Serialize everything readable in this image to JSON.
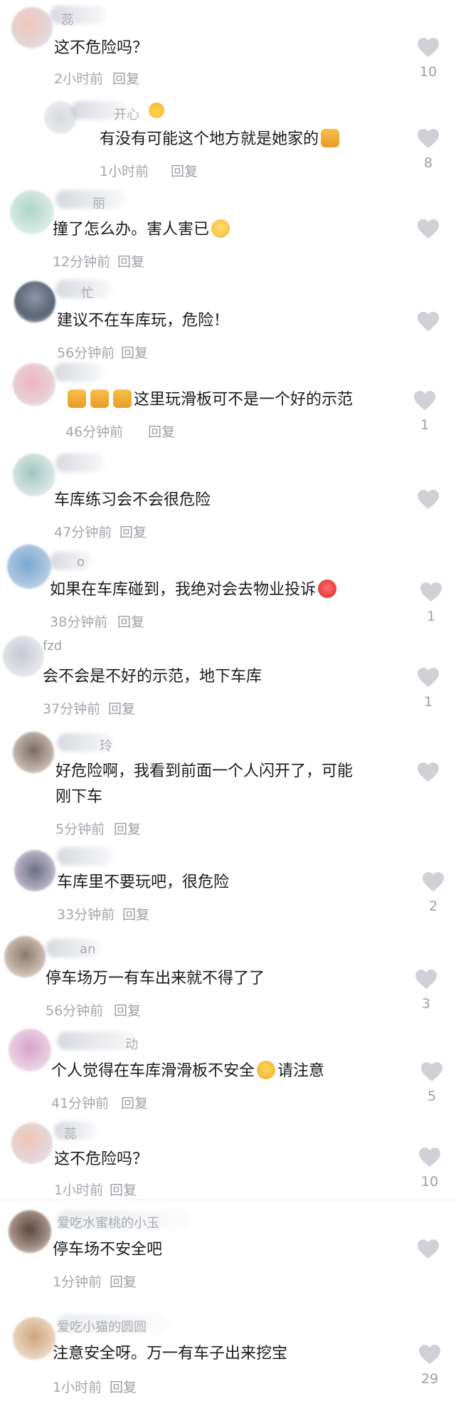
{
  "colors": {
    "text": "#1b1b1f",
    "meta": "#a3a6ad",
    "heart": "#cfd1d6"
  },
  "comments": [
    {
      "name_fragment": "蕊",
      "text": "这不危险吗？",
      "time": "2小时前",
      "reply": "回复",
      "likes": "10"
    },
    {
      "name_fragment": "开心",
      "text": "有没有可能这个地方就是她家的",
      "time": "1小时前",
      "reply": "回复",
      "likes": "8"
    },
    {
      "name_fragment": "丽",
      "text": "撞了怎么办。害人害已",
      "time": "12分钟前",
      "reply": "回复",
      "likes": ""
    },
    {
      "name_fragment": "忙",
      "text": "建议不在车库玩，危险！",
      "time": "56分钟前",
      "reply": "回复",
      "likes": ""
    },
    {
      "name_fragment": "",
      "text": "这里玩滑板可不是一个好的示范",
      "time": "46分钟前",
      "reply": "回复",
      "likes": "1"
    },
    {
      "name_fragment": "",
      "text": "车库练习会不会很危险",
      "time": "47分钟前",
      "reply": "回复",
      "likes": ""
    },
    {
      "name_fragment": "o",
      "text": "如果在车库碰到，我绝对会去物业投诉",
      "time": "38分钟前",
      "reply": "回复",
      "likes": "1"
    },
    {
      "name_fragment": "fzd",
      "text": "会不会是不好的示范，地下车库",
      "time": "37分钟前",
      "reply": "回复",
      "likes": "1"
    },
    {
      "name_fragment": "玲",
      "text_line1": "好危险啊，我看到前面一个人闪开了，可能",
      "text_line2": "刚下车",
      "time": "5分钟前",
      "reply": "回复",
      "likes": ""
    },
    {
      "name_fragment": "",
      "text": "车库里不要玩吧，很危险",
      "time": "33分钟前",
      "reply": "回复",
      "likes": "2"
    },
    {
      "name_fragment": "an",
      "text": "停车场万一有车出来就不得了了",
      "time": "56分钟前",
      "reply": "回复",
      "likes": "3"
    },
    {
      "name_fragment": "动",
      "text": "个人觉得在车库滑滑板不安全",
      "text_after": "请注意",
      "time": "41分钟前",
      "reply": "回复",
      "likes": "5"
    },
    {
      "name_fragment": "蕊",
      "text": "这不危险吗？",
      "time": "1小时前",
      "reply": "回复",
      "likes": "10"
    },
    {
      "name_fragment": "爱吃水蜜桃的小玉",
      "text": "停车场不安全吧",
      "time": "1分钟前",
      "reply": "回复",
      "likes": ""
    },
    {
      "name_fragment": "爱吃小猫的圆圆",
      "text": "注意安全呀。万一有车子出来挖宝",
      "time": "1小时前",
      "reply": "回复",
      "likes": "29"
    }
  ]
}
